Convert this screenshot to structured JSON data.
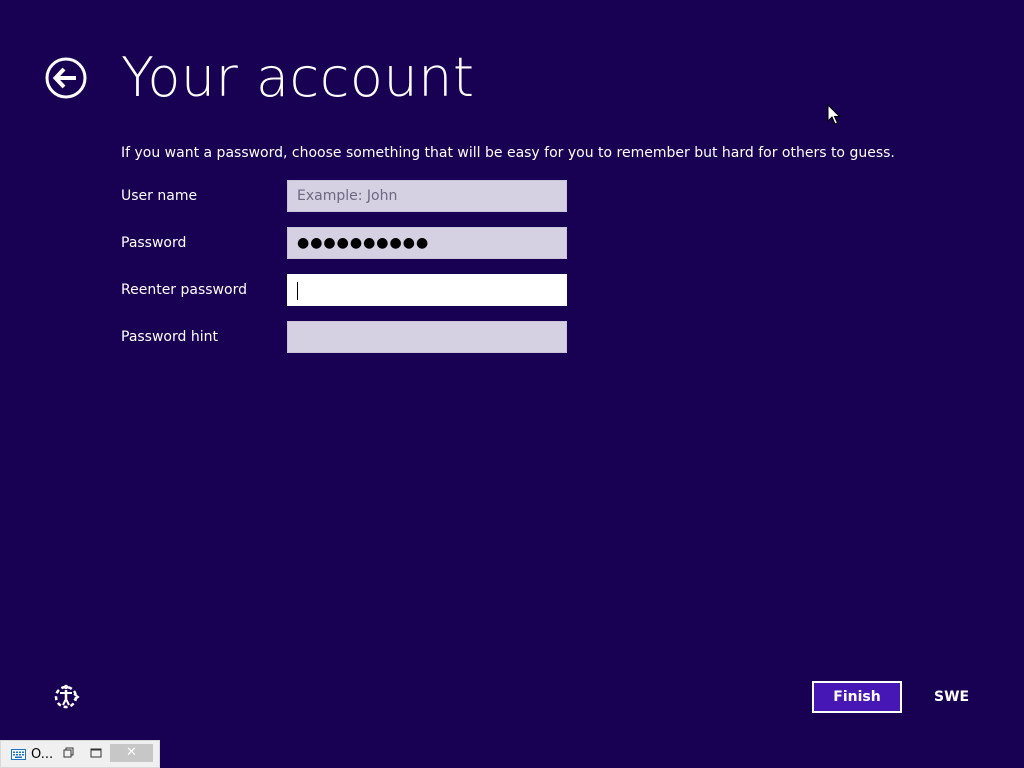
{
  "header": {
    "title": "Your account",
    "back_icon": "back-arrow-circle-icon"
  },
  "form": {
    "instructions": "If you want a password, choose something that will be easy for you to remember but hard for others to guess.",
    "fields": [
      {
        "label": "User name",
        "value": "",
        "placeholder": "Example: John"
      },
      {
        "label": "Password",
        "value": "●●●●●●●●●●",
        "placeholder": ""
      },
      {
        "label": "Reenter password",
        "value": "",
        "placeholder": ""
      },
      {
        "label": "Password hint",
        "value": "",
        "placeholder": ""
      }
    ]
  },
  "footer": {
    "finish_label": "Finish",
    "language": "SWE",
    "ease_icon": "ease-of-access-icon"
  },
  "taskbar": {
    "label": "O...",
    "close_glyph": "✕"
  },
  "colors": {
    "background": "#180052",
    "accent_button": "#4617b4",
    "field_inactive": "#d5d0e2",
    "field_active": "#ffffff"
  }
}
